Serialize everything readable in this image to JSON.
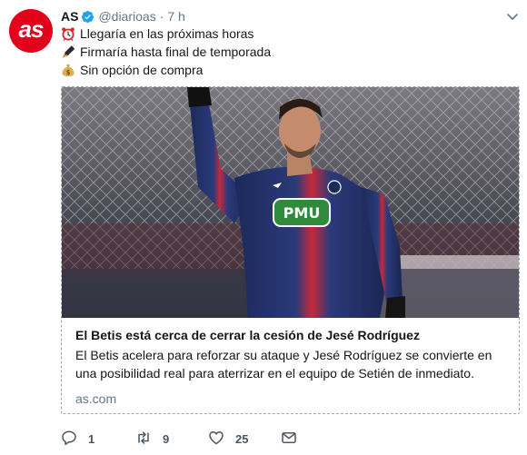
{
  "account": {
    "avatar_text": "as",
    "display_name": "AS",
    "handle": "@diarioas",
    "separator": "·",
    "time": "7 h"
  },
  "colors": {
    "brand": "#e2001a",
    "verified": "#1da1f2",
    "muted": "#657786"
  },
  "tweet_lines": [
    {
      "icon": "alarm-clock-icon",
      "text": "Llegaría en las próximas horas"
    },
    {
      "icon": "fountain-pen-icon",
      "text": "Firmaría hasta final de temporada"
    },
    {
      "icon": "money-bag-icon",
      "text": "Sin opción de compra"
    }
  ],
  "card": {
    "image_description": "football-player-photo",
    "player_shirt_text": "PMU",
    "title": "El Betis está cerca de cerrar la cesión de Jesé Rodríguez",
    "description": "El Betis acelera para reforzar su ataque y Jesé Rodríguez se convierte en una posibilidad real para aterrizar en el equipo de Setién de inmediato.",
    "domain": "as.com"
  },
  "actions": {
    "reply_count": "1",
    "retweet_count": "9",
    "like_count": "25",
    "reply_icon": "reply-icon",
    "retweet_icon": "retweet-icon",
    "like_icon": "heart-icon",
    "dm_icon": "envelope-icon"
  }
}
